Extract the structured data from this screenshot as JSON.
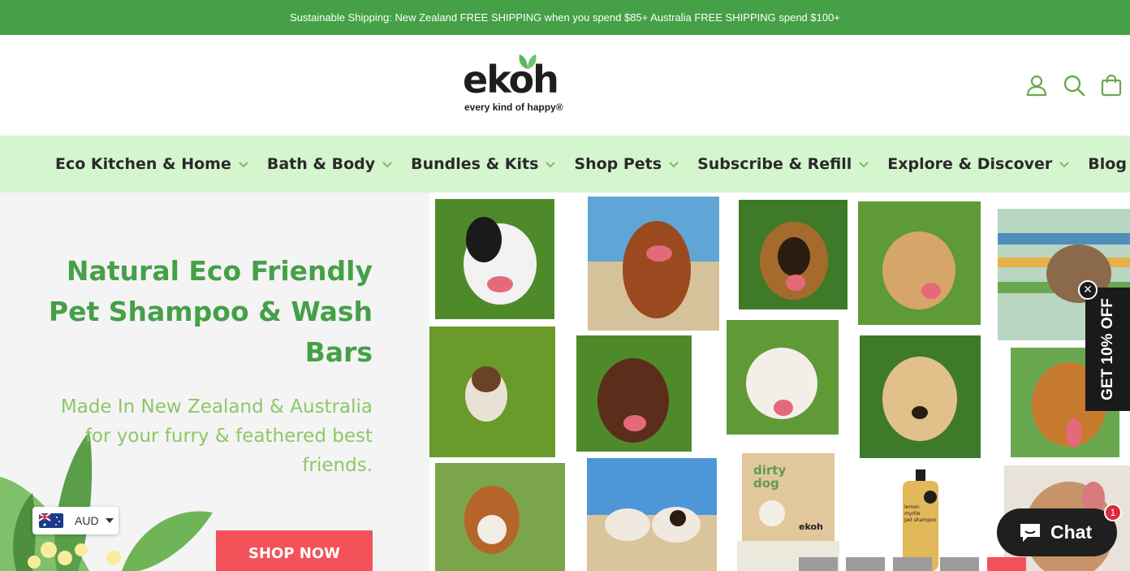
{
  "announcement": {
    "text": "Sustainable Shipping: New Zealand FREE SHIPPING when you spend $85+ Australia FREE SHIPPING spend $100+"
  },
  "header": {
    "logo_word": "ekoh",
    "logo_tagline": "every kind of happy®",
    "icons": [
      "account-icon",
      "search-icon",
      "cart-icon"
    ]
  },
  "nav": {
    "items": [
      {
        "label": "Eco Kitchen & Home",
        "has_dropdown": true
      },
      {
        "label": "Bath & Body",
        "has_dropdown": true
      },
      {
        "label": "Bundles & Kits",
        "has_dropdown": true
      },
      {
        "label": "Shop Pets",
        "has_dropdown": true
      },
      {
        "label": "Subscribe & Refill",
        "has_dropdown": true
      },
      {
        "label": "Explore & Discover",
        "has_dropdown": true
      },
      {
        "label": "Blog",
        "has_dropdown": false
      }
    ]
  },
  "hero": {
    "title": "Natural Eco Friendly Pet Shampoo & Wash Bars",
    "subtitle_line1": "Made In New Zealand & Australia",
    "subtitle_line2": "for your furry & feathered best friends.",
    "cta": "SHOP NOW"
  },
  "currency": {
    "selected": "AUD",
    "flag": "australia-flag-icon"
  },
  "promo": {
    "label": "GET 10% OFF",
    "close": "✕"
  },
  "chat": {
    "label": "Chat",
    "badge": "1"
  },
  "products": {
    "box_line1": "dirty",
    "box_line2": "dog",
    "box_brand": "ekoh",
    "bottle_line1": "lemon",
    "bottle_line2": "myrtle",
    "bottle_line3": "pet shampoo"
  },
  "colors": {
    "brand_green": "#45a047",
    "light_green": "#8bc867",
    "nav_bg": "#d5f5cf",
    "cta_red": "#f4525a",
    "dark": "#1f1f1f"
  }
}
